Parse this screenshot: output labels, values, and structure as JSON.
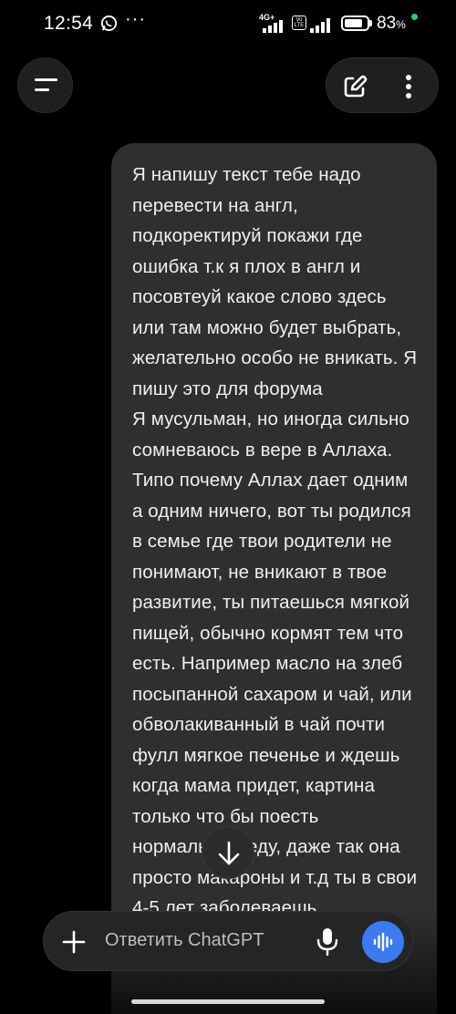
{
  "status_bar": {
    "time": "12:54",
    "more": "···",
    "network": "4G+",
    "volte": "Vo LTE",
    "battery_percent": "83",
    "battery_sign": "%",
    "battery_level": 0.83
  },
  "header": {
    "menu_icon": "menu-icon",
    "new_chat_icon": "edit-icon",
    "more_icon": "kebab-icon"
  },
  "message": {
    "text": "Я напишу текст тебе надо перевести на англ, подкоректируй покажи где ошибка т.к я плох в англ и посовтеуй какое слово здесь или там можно будет выбрать, желательно особо не вникать. Я пишу это для форума\nЯ мусульман, но иногда сильно сомневаюсь в вере в Аллаха. Типо почему Аллах дает одним а одним ничего, вот ты родился в семье где твои родители не понимают, не вникают в твое развитие, ты питаешься мягкой пищей, обычно кормят тем что есть. Например масло на злеб посыпанной сахаром и чай, или обволакиванный в чай почти фулл мягкое печенье и ждешь когда мама придет, картина только что бы поесть нормальную еду, даже так она просто макароны и т.д ты в свои 4-5 лет заболеваешь"
  },
  "composer": {
    "placeholder": "Ответить ChatGPT",
    "plus_icon": "plus-icon",
    "mic_icon": "mic-icon",
    "voice_icon": "voice-waveform-icon",
    "accent_color": "#3b7af0"
  },
  "scroll_icon": "arrow-down-icon"
}
